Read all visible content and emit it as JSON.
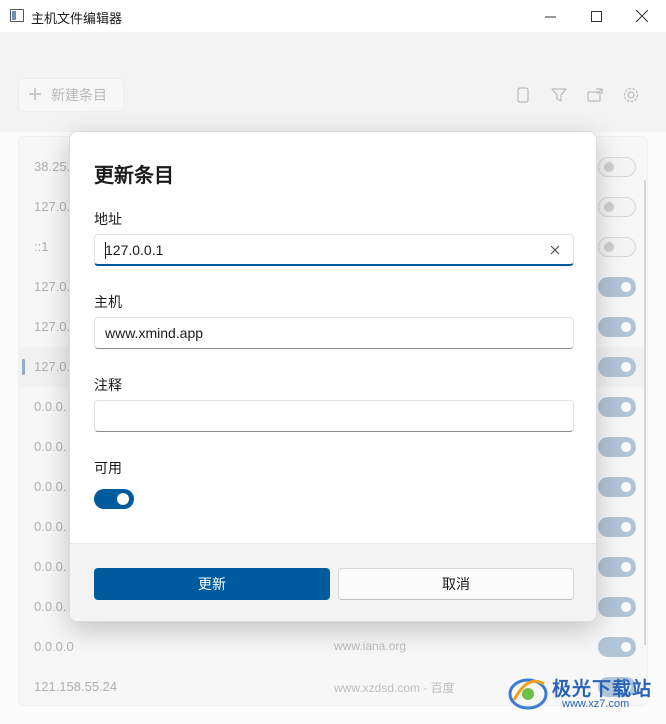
{
  "window": {
    "title": "主机文件编辑器"
  },
  "toolbar": {
    "new_entry_label": "新建条目",
    "icons": [
      "file-icon",
      "filter-icon",
      "export-icon",
      "settings-icon"
    ]
  },
  "list": {
    "rows": [
      {
        "address": "38.25.",
        "host": "",
        "enabled": false
      },
      {
        "address": "127.0.",
        "host": "",
        "enabled": false
      },
      {
        "address": "::1",
        "host": "",
        "enabled": false
      },
      {
        "address": "127.0.",
        "host": "",
        "enabled": true
      },
      {
        "address": "127.0.",
        "host": "",
        "enabled": true
      },
      {
        "address": "127.0.",
        "host": "",
        "enabled": true,
        "selected": true
      },
      {
        "address": "0.0.0.",
        "host": "",
        "enabled": true
      },
      {
        "address": "0.0.0.",
        "host": "",
        "enabled": true
      },
      {
        "address": "0.0.0.",
        "host": "",
        "enabled": true
      },
      {
        "address": "0.0.0.",
        "host": "",
        "enabled": true
      },
      {
        "address": "0.0.0.",
        "host": "",
        "enabled": true
      },
      {
        "address": "0.0.0.",
        "host": "",
        "enabled": true
      },
      {
        "address": "0.0.0.0",
        "host": "www.iana.org",
        "enabled": true
      },
      {
        "address": "121.158.55.24",
        "host": "www.xzdsd.com - 百度",
        "enabled": true
      }
    ]
  },
  "dialog": {
    "title": "更新条目",
    "address_label": "地址",
    "address_value": "127.0.0.1",
    "host_label": "主机",
    "host_value": "www.xmind.app",
    "comment_label": "注释",
    "comment_value": "",
    "enabled_label": "可用",
    "enabled": true,
    "update_button": "更新",
    "cancel_button": "取消"
  },
  "watermark": {
    "text": "极光下载站",
    "url": "www.xz7.com"
  },
  "colors": {
    "accent": "#005a9e",
    "toggle_bg_on": "#8eadc9"
  }
}
